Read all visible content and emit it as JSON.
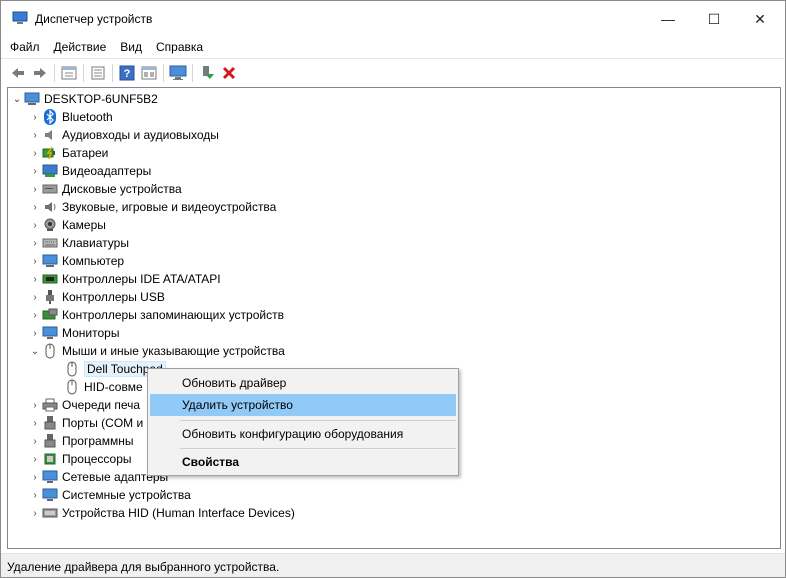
{
  "window": {
    "title": "Диспетчер устройств",
    "controls": {
      "minimize": "—",
      "maximize": "☐",
      "close": "✕"
    }
  },
  "menu": [
    "Файл",
    "Действие",
    "Вид",
    "Справка"
  ],
  "toolbar": [
    "back-icon",
    "forward-icon",
    "properties-icon",
    "view-icon",
    "help-icon",
    "list-icon",
    "monitor-icon",
    "enable-driver-icon",
    "uninstall-icon"
  ],
  "tree": {
    "root": "DESKTOP-6UNF5B2",
    "items": [
      {
        "label": "Bluetooth",
        "icon": "bluetooth-icon"
      },
      {
        "label": "Аудиовходы и аудиовыходы",
        "icon": "speaker-icon"
      },
      {
        "label": "Батареи",
        "icon": "battery-icon"
      },
      {
        "label": "Видеоадаптеры",
        "icon": "display-adapter-icon"
      },
      {
        "label": "Дисковые устройства",
        "icon": "disk-icon"
      },
      {
        "label": "Звуковые, игровые и видеоустройства",
        "icon": "sound-icon"
      },
      {
        "label": "Камеры",
        "icon": "camera-icon"
      },
      {
        "label": "Клавиатуры",
        "icon": "keyboard-icon"
      },
      {
        "label": "Компьютер",
        "icon": "computer-icon"
      },
      {
        "label": "Контроллеры IDE ATA/ATAPI",
        "icon": "ide-icon"
      },
      {
        "label": "Контроллеры USB",
        "icon": "usb-icon"
      },
      {
        "label": "Контроллеры запоминающих устройств",
        "icon": "storage-icon"
      },
      {
        "label": "Мониторы",
        "icon": "monitor-icon"
      },
      {
        "label": "Мыши и иные указывающие устройства",
        "icon": "mouse-icon"
      },
      {
        "label": "Dell Touchpad",
        "icon": "mouse-icon"
      },
      {
        "label": "HID-совме",
        "icon": "mouse-icon"
      },
      {
        "label": "Очереди печа",
        "icon": "printer-icon"
      },
      {
        "label": "Порты (COM и",
        "icon": "port-icon"
      },
      {
        "label": "Программны",
        "icon": "software-icon"
      },
      {
        "label": "Процессоры",
        "icon": "cpu-icon"
      },
      {
        "label": "Сетевые адаптеры",
        "icon": "network-icon"
      },
      {
        "label": "Системные устройства",
        "icon": "system-icon"
      },
      {
        "label": "Устройства HID (Human Interface Devices)",
        "icon": "hid-icon"
      }
    ]
  },
  "context_menu": {
    "update_driver": "Обновить драйвер",
    "uninstall_device": "Удалить устройство",
    "scan_hardware": "Обновить конфигурацию оборудования",
    "properties": "Свойства"
  },
  "status": "Удаление драйвера для выбранного устройства.",
  "colors": {
    "highlight": "#91c9f7",
    "selection": "#e5f1fb",
    "accent": "#0078d7"
  }
}
